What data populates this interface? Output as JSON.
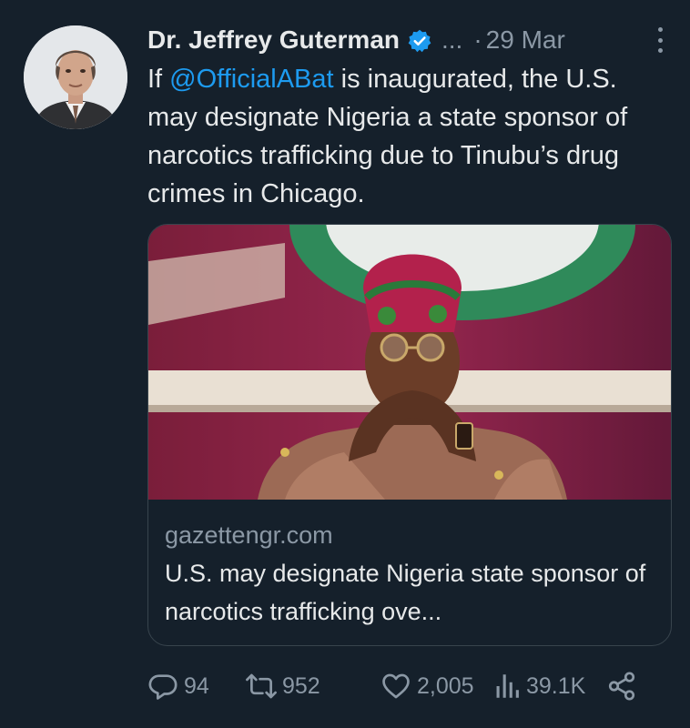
{
  "tweet": {
    "author_name": "Dr. Jeffrey Guterman",
    "handle": "...",
    "separator": "·",
    "time": "29 Mar",
    "text_prefix": "If ",
    "mention": "@OfficialABat",
    "text_suffix": " is inaugurated, the U.S. may designate Nigeria a state sponsor of narcotics trafficking due to Tinubu’s drug crimes in Chicago."
  },
  "card": {
    "domain": "gazettengr.com",
    "title": "U.S. may designate Nigeria state sponsor of narcotics trafficking ove..."
  },
  "actions": {
    "replies": "94",
    "reposts": "952",
    "likes": "2,005",
    "views": "39.1K"
  },
  "icons": [
    "verified-icon",
    "more-icon",
    "reply-icon",
    "repost-icon",
    "like-icon",
    "views-icon",
    "share-icon"
  ],
  "colors": {
    "background": "#15202b",
    "accent": "#1d9bf0",
    "text": "#e7e9ea",
    "muted": "#8b98a5",
    "border": "#38444d"
  }
}
